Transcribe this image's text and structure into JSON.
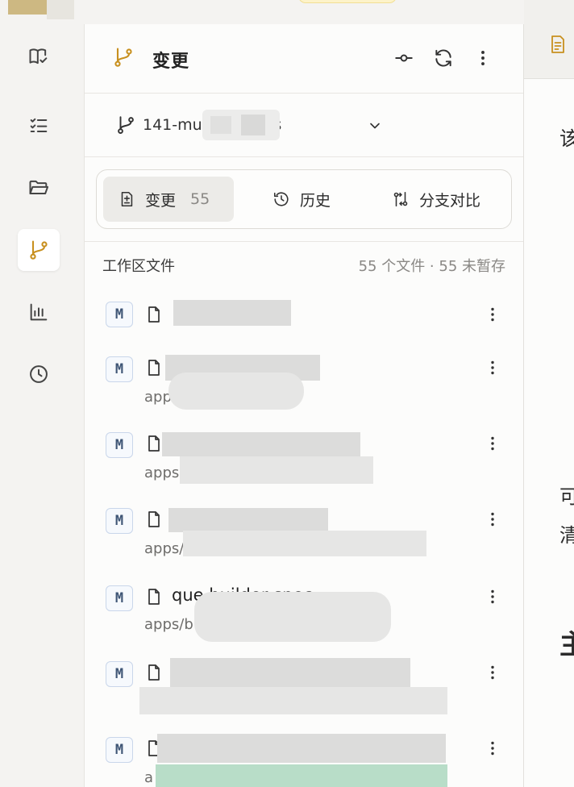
{
  "panel": {
    "title": "变更",
    "branch_label": "141-mu  positories",
    "tabs": [
      {
        "label": "变更",
        "count": "55"
      },
      {
        "label": "历史"
      },
      {
        "label": "分支对比"
      }
    ],
    "section_title": "工作区文件",
    "section_summary": "55 个文件 · 55 未暂存"
  },
  "files": [
    {
      "status": "M",
      "name": "",
      "path": ""
    },
    {
      "status": "M",
      "name": "",
      "path": "app                na"
    },
    {
      "status": "M",
      "name": "",
      "path": "apps"
    },
    {
      "status": "M",
      "name": "",
      "path": "apps/                              s..."
    },
    {
      "status": "M",
      "name": "que                  builder spec...",
      "path": "apps/b                        ent/s..."
    },
    {
      "status": "M",
      "name": "",
      "path": ""
    },
    {
      "status": "M",
      "name": "",
      "path": "a"
    }
  ],
  "right_panel": {
    "lines": [
      "该",
      "可",
      "清",
      "主"
    ]
  },
  "colors": {
    "accent": "#c8901f",
    "badge_border": "#c9d6ea",
    "badge_text": "#3e5575"
  },
  "icons": {
    "rail": [
      "book-check-icon",
      "list-checks-icon",
      "folder-open-icon",
      "git-branch-icon",
      "bar-chart-icon",
      "clock-icon"
    ],
    "header": [
      "git-commit-icon",
      "refresh-icon",
      "more-vertical-icon"
    ]
  }
}
